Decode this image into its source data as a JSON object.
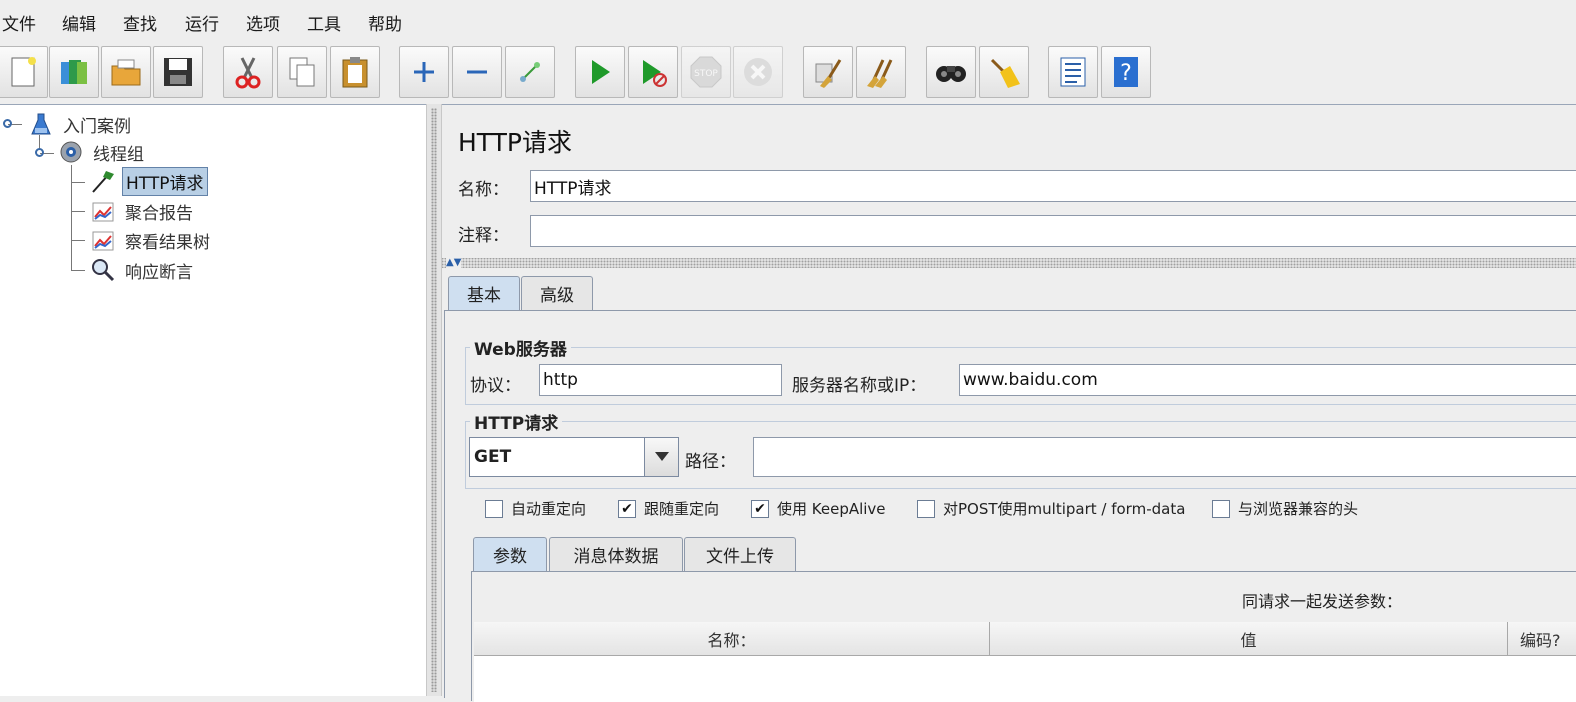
{
  "menu": [
    "文件",
    "编辑",
    "查找",
    "运行",
    "选项",
    "工具",
    "帮助"
  ],
  "toolbar": {
    "buttons": [
      {
        "name": "new-icon"
      },
      {
        "name": "templates-icon"
      },
      {
        "name": "open-icon"
      },
      {
        "name": "save-icon"
      },
      {
        "name": "cut-icon"
      },
      {
        "name": "copy-icon"
      },
      {
        "name": "paste-icon"
      },
      {
        "name": "expand-icon"
      },
      {
        "name": "collapse-icon"
      },
      {
        "name": "toggle-icon"
      },
      {
        "name": "start-icon"
      },
      {
        "name": "start-no-pause-icon"
      },
      {
        "name": "stop-icon",
        "disabled": true
      },
      {
        "name": "shutdown-icon",
        "disabled": true
      },
      {
        "name": "clear-icon"
      },
      {
        "name": "clear-all-icon"
      },
      {
        "name": "search-icon"
      },
      {
        "name": "reset-search-icon"
      },
      {
        "name": "function-helper-icon"
      },
      {
        "name": "help-icon"
      }
    ],
    "stop_text": "STOP"
  },
  "tree": {
    "nodes": [
      {
        "label": "入门案例",
        "icon": "test-plan-icon"
      },
      {
        "label": "线程组",
        "icon": "thread-group-icon"
      },
      {
        "label": "HTTP请求",
        "icon": "sampler-icon",
        "selected": true
      },
      {
        "label": "聚合报告",
        "icon": "graph-icon"
      },
      {
        "label": "察看结果树",
        "icon": "graph-icon"
      },
      {
        "label": "响应断言",
        "icon": "magnifier-icon"
      }
    ]
  },
  "panel": {
    "title": "HTTP请求",
    "name_label": "名称：",
    "name_value": "HTTP请求",
    "comment_label": "注释：",
    "comment_value": "",
    "tabs": [
      "基本",
      "高级"
    ],
    "web_server": {
      "legend": "Web服务器",
      "protocol_label": "协议：",
      "protocol_value": "http",
      "server_label": "服务器名称或IP：",
      "server_value": "www.baidu.com"
    },
    "http_request": {
      "legend": "HTTP请求",
      "method": "GET",
      "path_label": "路径：",
      "path_value": ""
    },
    "checkboxes": [
      {
        "label": "自动重定向",
        "checked": false
      },
      {
        "label": "跟随重定向",
        "checked": true
      },
      {
        "label": "使用 KeepAlive",
        "checked": true
      },
      {
        "label": "对POST使用multipart / form-data",
        "checked": false
      },
      {
        "label": "与浏览器兼容的头",
        "checked": false
      }
    ],
    "sub_tabs": [
      "参数",
      "消息体数据",
      "文件上传"
    ],
    "params_caption": "同请求一起发送参数：",
    "columns": [
      "名称：",
      "值",
      "编码?"
    ]
  }
}
